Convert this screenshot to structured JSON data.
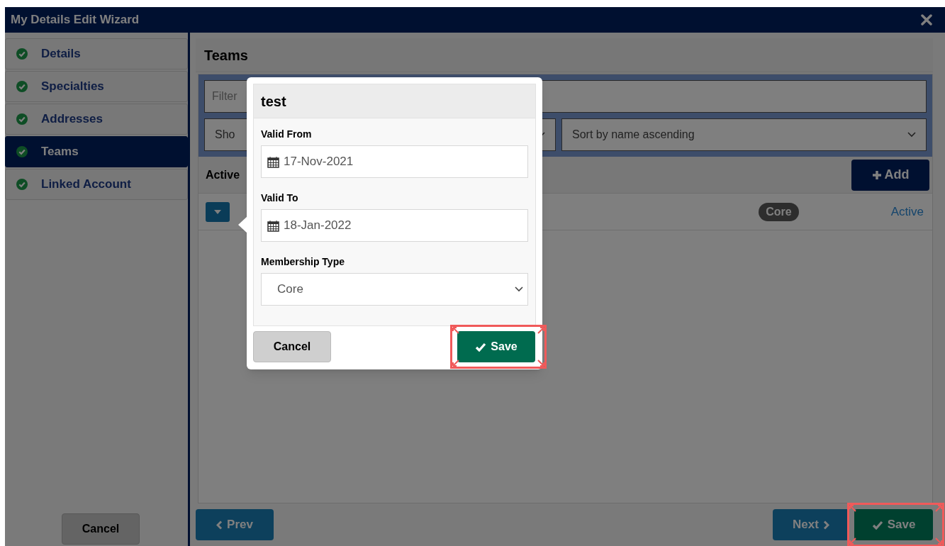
{
  "window": {
    "title": "My Details Edit Wizard"
  },
  "sidebar": {
    "items": [
      {
        "label": "Details",
        "completed": true,
        "selected": false
      },
      {
        "label": "Specialties",
        "completed": true,
        "selected": false
      },
      {
        "label": "Addresses",
        "completed": true,
        "selected": false
      },
      {
        "label": "Teams",
        "completed": true,
        "selected": true
      },
      {
        "label": "Linked Account",
        "completed": true,
        "selected": false
      }
    ],
    "cancel_button": "Cancel"
  },
  "content": {
    "title": "Teams",
    "filter": {
      "placeholder": "Filter"
    },
    "show_select": {
      "value": "Sho"
    },
    "sort_select": {
      "value": "Sort by name ascending"
    },
    "list_header": "Active",
    "add_button": "Add",
    "rows": [
      {
        "membership": "Core",
        "status": "Active"
      }
    ]
  },
  "popover": {
    "title": "test",
    "fields": [
      {
        "kind": "date",
        "label": "Valid From",
        "value": "17-Nov-2021"
      },
      {
        "kind": "date",
        "label": "Valid To",
        "value": "18-Jan-2022"
      },
      {
        "kind": "select",
        "label": "Membership Type",
        "value": "Core"
      }
    ],
    "cancel_button": "Cancel",
    "save_button": {
      "label": "Save",
      "highlighted": true
    }
  },
  "footer": {
    "prev_button": "Prev",
    "next_button": "Next",
    "save_button": {
      "label": "Save",
      "highlighted": true
    }
  }
}
